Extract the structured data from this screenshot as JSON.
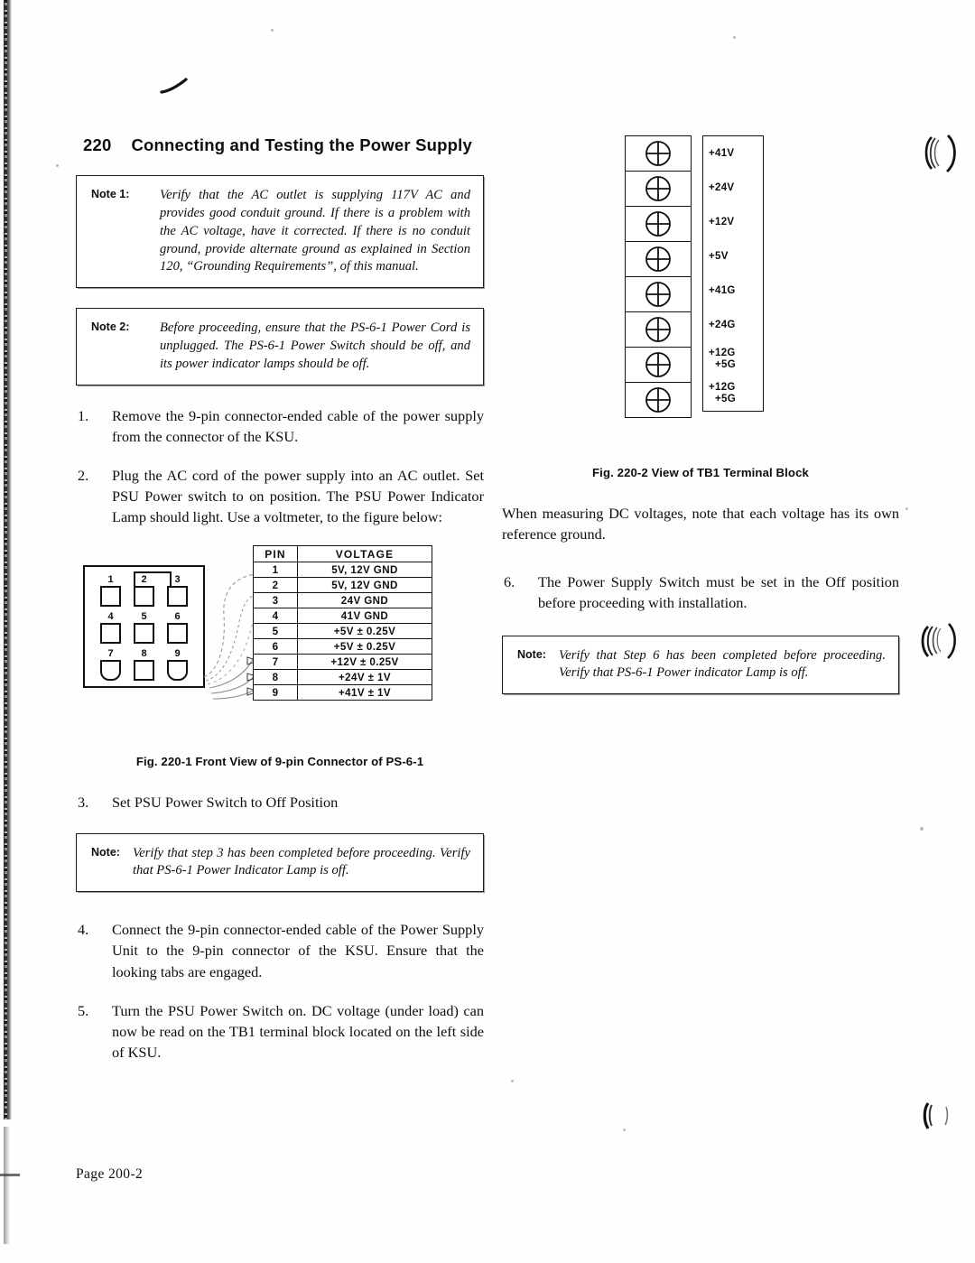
{
  "document": {
    "section_number": "220",
    "section_title": "Connecting and Testing the Power Supply",
    "page_footer": "Page  200-2"
  },
  "notes": [
    {
      "label": "Note 1:",
      "text": "Verify that the AC outlet is supplying 117V AC and provides good conduit ground. If there is a problem with the AC voltage, have it corrected. If there is no conduit ground, provide alternate ground as explained in Section 120, “Grounding Requirements”, of this manual."
    },
    {
      "label": "Note 2:",
      "text": "Before proceeding, ensure that the PS-6-1 Power Cord is unplugged. The PS-6-1 Power Switch should be off, and its power indicator lamps should be off."
    },
    {
      "label": "Note:",
      "text": "Verify that step 3 has been completed before proceeding. Verify that PS-6-1 Power Indicator Lamp is off."
    },
    {
      "label": "Note:",
      "text": "Verify that Step 6 has been completed before proceeding. Verify that PS-6-1 Power indicator Lamp is off."
    }
  ],
  "steps": [
    {
      "num": "1.",
      "text": "Remove the 9-pin connector-ended cable of the power supply from the connector of the KSU."
    },
    {
      "num": "2.",
      "text": "Plug the AC cord of the power supply into an AC outlet. Set PSU Power switch to on position. The PSU Power Indicator Lamp should light. Use a voltmeter, to the figure below:"
    },
    {
      "num": "3.",
      "text": "Set PSU Power Switch to Off Position"
    },
    {
      "num": "4.",
      "text": "Connect the 9-pin connector-ended cable of the Power Supply Unit to the 9-pin connector of the KSU. Ensure that the looking tabs are engaged."
    },
    {
      "num": "5.",
      "text": "Turn the PSU Power Switch on. DC voltage (under load) can now be read on the TB1 terminal block located on the left side of KSU."
    },
    {
      "num": "6.",
      "text": "The Power Supply Switch must be set in the Off position before proceeding with installation."
    }
  ],
  "paragraphs": {
    "dc_reference": "When measuring DC voltages, note that each voltage has its own reference ground."
  },
  "figure_220_1": {
    "caption": "Fig. 220-1   Front View of 9-pin Connector of PS-6-1",
    "pins": [
      {
        "num": "1",
        "shape": "square"
      },
      {
        "num": "2",
        "shape": "square"
      },
      {
        "num": "3",
        "shape": "square"
      },
      {
        "num": "4",
        "shape": "square"
      },
      {
        "num": "5",
        "shape": "square"
      },
      {
        "num": "6",
        "shape": "square"
      },
      {
        "num": "7",
        "shape": "dshape"
      },
      {
        "num": "8",
        "shape": "square"
      },
      {
        "num": "9",
        "shape": "dshape"
      }
    ],
    "table": {
      "headers": [
        "PIN",
        "VOLTAGE"
      ],
      "rows": [
        [
          "1",
          "5V, 12V GND"
        ],
        [
          "2",
          "5V, 12V GND"
        ],
        [
          "3",
          "24V GND"
        ],
        [
          "4",
          "41V GND"
        ],
        [
          "5",
          "+5V ± 0.25V"
        ],
        [
          "6",
          "+5V ± 0.25V"
        ],
        [
          "7",
          "+12V ± 0.25V"
        ],
        [
          "8",
          "+24V ± 1V"
        ],
        [
          "9",
          "+41V ± 1V"
        ]
      ]
    }
  },
  "figure_220_2": {
    "caption": "Fig. 220-2   View of TB1 Terminal Block",
    "terminals": [
      {
        "label_1": "+41V",
        "label_2": ""
      },
      {
        "label_1": "+24V",
        "label_2": ""
      },
      {
        "label_1": "+12V",
        "label_2": ""
      },
      {
        "label_1": "+5V",
        "label_2": ""
      },
      {
        "label_1": "+41G",
        "label_2": ""
      },
      {
        "label_1": "+24G",
        "label_2": ""
      },
      {
        "label_1": "+12G",
        "label_2": "+5G"
      },
      {
        "label_1": "+12G",
        "label_2": "+5G"
      }
    ]
  },
  "colors": {
    "ink": "#0d0d0d",
    "paper": "#fefefe",
    "rule": "#111111"
  }
}
